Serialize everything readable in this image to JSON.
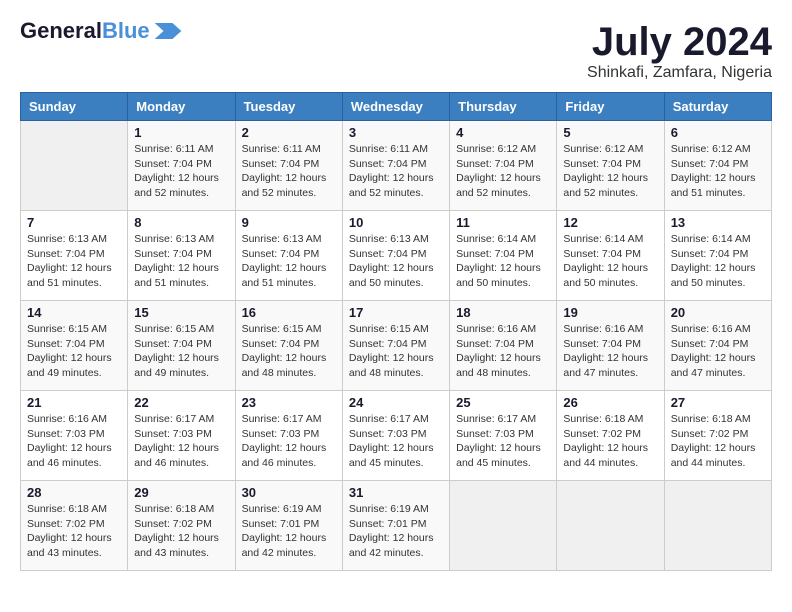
{
  "header": {
    "logo_line1": "General",
    "logo_line2": "Blue",
    "title": "July 2024",
    "location": "Shinkafi, Zamfara, Nigeria"
  },
  "weekdays": [
    "Sunday",
    "Monday",
    "Tuesday",
    "Wednesday",
    "Thursday",
    "Friday",
    "Saturday"
  ],
  "weeks": [
    [
      {
        "day": "",
        "sunrise": "",
        "sunset": "",
        "daylight": ""
      },
      {
        "day": "1",
        "sunrise": "Sunrise: 6:11 AM",
        "sunset": "Sunset: 7:04 PM",
        "daylight": "Daylight: 12 hours and 52 minutes."
      },
      {
        "day": "2",
        "sunrise": "Sunrise: 6:11 AM",
        "sunset": "Sunset: 7:04 PM",
        "daylight": "Daylight: 12 hours and 52 minutes."
      },
      {
        "day": "3",
        "sunrise": "Sunrise: 6:11 AM",
        "sunset": "Sunset: 7:04 PM",
        "daylight": "Daylight: 12 hours and 52 minutes."
      },
      {
        "day": "4",
        "sunrise": "Sunrise: 6:12 AM",
        "sunset": "Sunset: 7:04 PM",
        "daylight": "Daylight: 12 hours and 52 minutes."
      },
      {
        "day": "5",
        "sunrise": "Sunrise: 6:12 AM",
        "sunset": "Sunset: 7:04 PM",
        "daylight": "Daylight: 12 hours and 52 minutes."
      },
      {
        "day": "6",
        "sunrise": "Sunrise: 6:12 AM",
        "sunset": "Sunset: 7:04 PM",
        "daylight": "Daylight: 12 hours and 51 minutes."
      }
    ],
    [
      {
        "day": "7",
        "sunrise": "Sunrise: 6:13 AM",
        "sunset": "Sunset: 7:04 PM",
        "daylight": "Daylight: 12 hours and 51 minutes."
      },
      {
        "day": "8",
        "sunrise": "Sunrise: 6:13 AM",
        "sunset": "Sunset: 7:04 PM",
        "daylight": "Daylight: 12 hours and 51 minutes."
      },
      {
        "day": "9",
        "sunrise": "Sunrise: 6:13 AM",
        "sunset": "Sunset: 7:04 PM",
        "daylight": "Daylight: 12 hours and 51 minutes."
      },
      {
        "day": "10",
        "sunrise": "Sunrise: 6:13 AM",
        "sunset": "Sunset: 7:04 PM",
        "daylight": "Daylight: 12 hours and 50 minutes."
      },
      {
        "day": "11",
        "sunrise": "Sunrise: 6:14 AM",
        "sunset": "Sunset: 7:04 PM",
        "daylight": "Daylight: 12 hours and 50 minutes."
      },
      {
        "day": "12",
        "sunrise": "Sunrise: 6:14 AM",
        "sunset": "Sunset: 7:04 PM",
        "daylight": "Daylight: 12 hours and 50 minutes."
      },
      {
        "day": "13",
        "sunrise": "Sunrise: 6:14 AM",
        "sunset": "Sunset: 7:04 PM",
        "daylight": "Daylight: 12 hours and 50 minutes."
      }
    ],
    [
      {
        "day": "14",
        "sunrise": "Sunrise: 6:15 AM",
        "sunset": "Sunset: 7:04 PM",
        "daylight": "Daylight: 12 hours and 49 minutes."
      },
      {
        "day": "15",
        "sunrise": "Sunrise: 6:15 AM",
        "sunset": "Sunset: 7:04 PM",
        "daylight": "Daylight: 12 hours and 49 minutes."
      },
      {
        "day": "16",
        "sunrise": "Sunrise: 6:15 AM",
        "sunset": "Sunset: 7:04 PM",
        "daylight": "Daylight: 12 hours and 48 minutes."
      },
      {
        "day": "17",
        "sunrise": "Sunrise: 6:15 AM",
        "sunset": "Sunset: 7:04 PM",
        "daylight": "Daylight: 12 hours and 48 minutes."
      },
      {
        "day": "18",
        "sunrise": "Sunrise: 6:16 AM",
        "sunset": "Sunset: 7:04 PM",
        "daylight": "Daylight: 12 hours and 48 minutes."
      },
      {
        "day": "19",
        "sunrise": "Sunrise: 6:16 AM",
        "sunset": "Sunset: 7:04 PM",
        "daylight": "Daylight: 12 hours and 47 minutes."
      },
      {
        "day": "20",
        "sunrise": "Sunrise: 6:16 AM",
        "sunset": "Sunset: 7:04 PM",
        "daylight": "Daylight: 12 hours and 47 minutes."
      }
    ],
    [
      {
        "day": "21",
        "sunrise": "Sunrise: 6:16 AM",
        "sunset": "Sunset: 7:03 PM",
        "daylight": "Daylight: 12 hours and 46 minutes."
      },
      {
        "day": "22",
        "sunrise": "Sunrise: 6:17 AM",
        "sunset": "Sunset: 7:03 PM",
        "daylight": "Daylight: 12 hours and 46 minutes."
      },
      {
        "day": "23",
        "sunrise": "Sunrise: 6:17 AM",
        "sunset": "Sunset: 7:03 PM",
        "daylight": "Daylight: 12 hours and 46 minutes."
      },
      {
        "day": "24",
        "sunrise": "Sunrise: 6:17 AM",
        "sunset": "Sunset: 7:03 PM",
        "daylight": "Daylight: 12 hours and 45 minutes."
      },
      {
        "day": "25",
        "sunrise": "Sunrise: 6:17 AM",
        "sunset": "Sunset: 7:03 PM",
        "daylight": "Daylight: 12 hours and 45 minutes."
      },
      {
        "day": "26",
        "sunrise": "Sunrise: 6:18 AM",
        "sunset": "Sunset: 7:02 PM",
        "daylight": "Daylight: 12 hours and 44 minutes."
      },
      {
        "day": "27",
        "sunrise": "Sunrise: 6:18 AM",
        "sunset": "Sunset: 7:02 PM",
        "daylight": "Daylight: 12 hours and 44 minutes."
      }
    ],
    [
      {
        "day": "28",
        "sunrise": "Sunrise: 6:18 AM",
        "sunset": "Sunset: 7:02 PM",
        "daylight": "Daylight: 12 hours and 43 minutes."
      },
      {
        "day": "29",
        "sunrise": "Sunrise: 6:18 AM",
        "sunset": "Sunset: 7:02 PM",
        "daylight": "Daylight: 12 hours and 43 minutes."
      },
      {
        "day": "30",
        "sunrise": "Sunrise: 6:19 AM",
        "sunset": "Sunset: 7:01 PM",
        "daylight": "Daylight: 12 hours and 42 minutes."
      },
      {
        "day": "31",
        "sunrise": "Sunrise: 6:19 AM",
        "sunset": "Sunset: 7:01 PM",
        "daylight": "Daylight: 12 hours and 42 minutes."
      },
      {
        "day": "",
        "sunrise": "",
        "sunset": "",
        "daylight": ""
      },
      {
        "day": "",
        "sunrise": "",
        "sunset": "",
        "daylight": ""
      },
      {
        "day": "",
        "sunrise": "",
        "sunset": "",
        "daylight": ""
      }
    ]
  ]
}
